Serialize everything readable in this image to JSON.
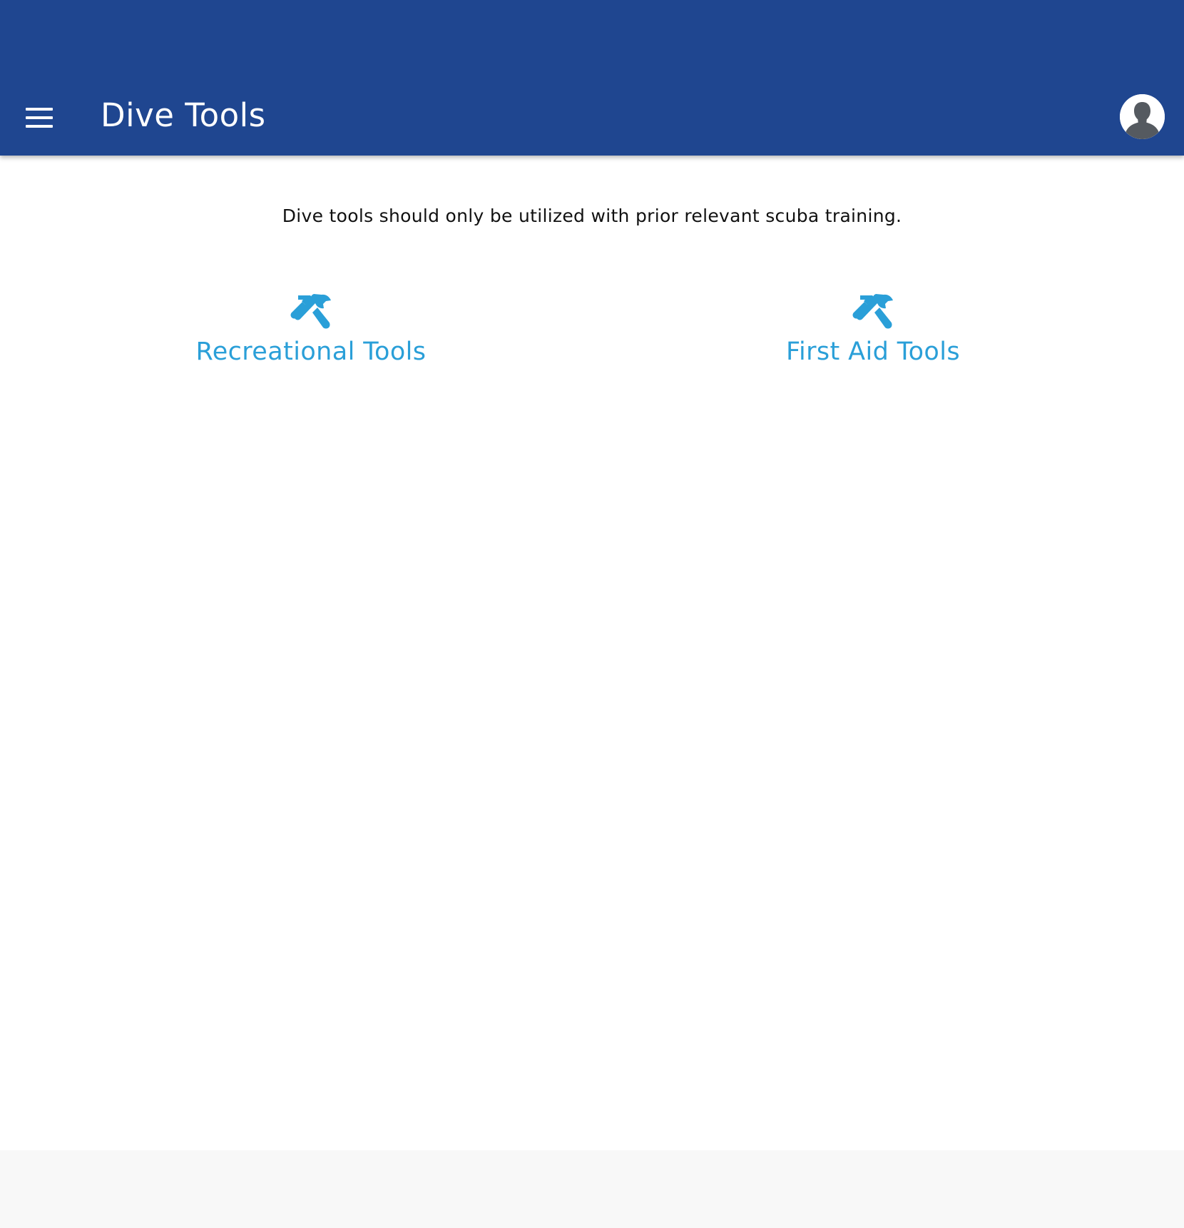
{
  "app": {
    "title": "Dive Tools"
  },
  "icons": {
    "menu": "menu-icon",
    "avatar": "user-avatar-icon",
    "tools": "hammer-wrench-icon"
  },
  "colors": {
    "appbar": "#1f4690",
    "accent": "#2a9fd8",
    "footer": "#f8f8f8"
  },
  "main": {
    "notice": "Dive tools should only be utilized with prior relevant scuba training.",
    "links": [
      {
        "label": "Recreational Tools"
      },
      {
        "label": "First Aid Tools"
      }
    ]
  }
}
